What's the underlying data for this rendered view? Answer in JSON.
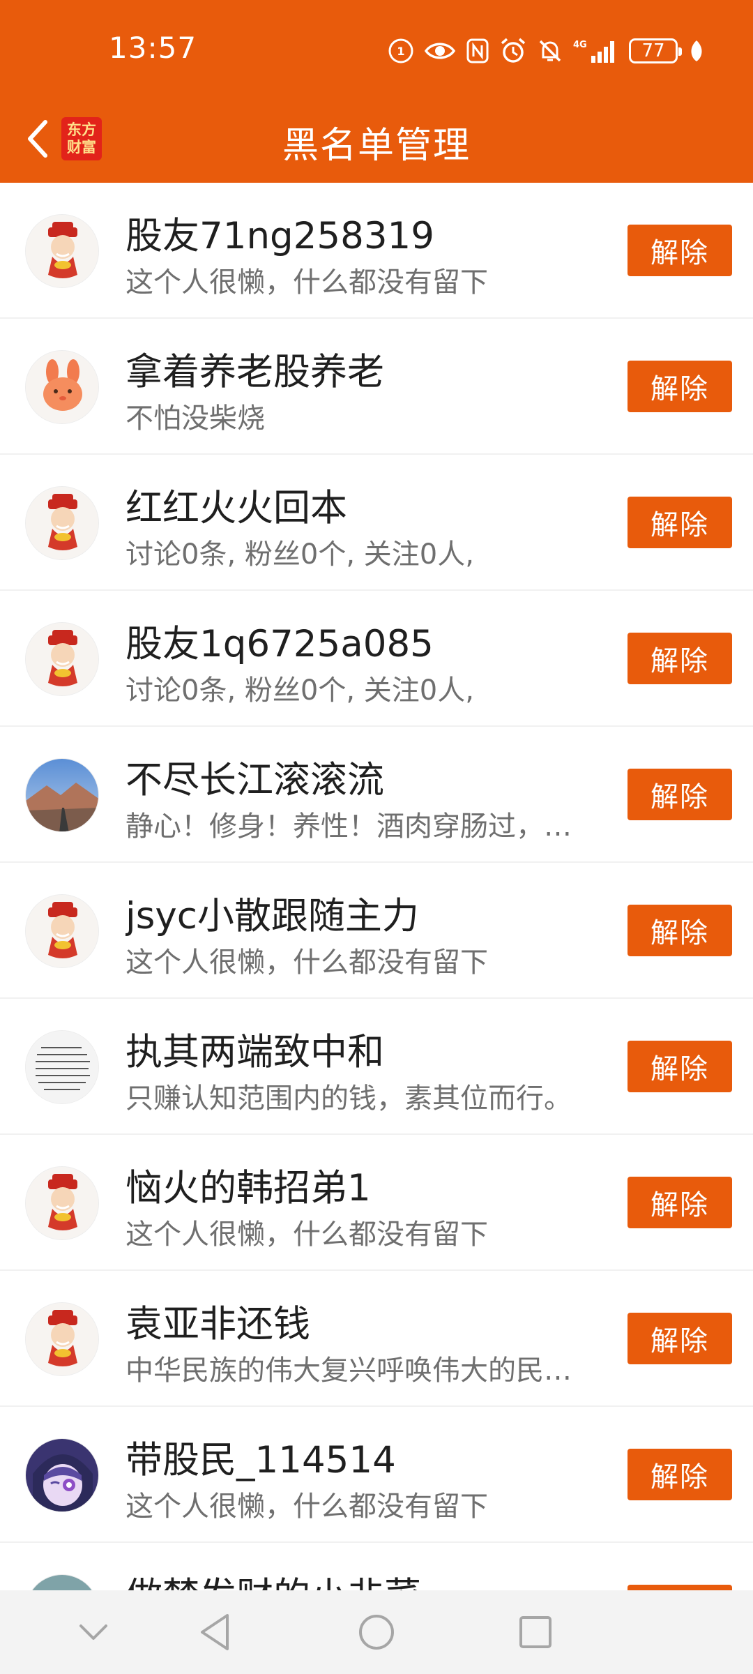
{
  "status": {
    "time": "13:57",
    "battery": "77"
  },
  "header": {
    "title": "黑名单管理",
    "logo_line1": "东方",
    "logo_line2": "财富"
  },
  "items": [
    {
      "name": "股友71ng258319",
      "bio": "这个人很懒，什么都没有留下",
      "button": "解除",
      "avatar": "caishen-avatar"
    },
    {
      "name": "拿着养老股养老",
      "bio": "不怕没柴烧",
      "button": "解除",
      "avatar": "rabbit-avatar"
    },
    {
      "name": "红红火火回本",
      "bio": "讨论0条, 粉丝0个, 关注0人,",
      "button": "解除",
      "avatar": "caishen-avatar"
    },
    {
      "name": "股友1q6725a085",
      "bio": "讨论0条, 粉丝0个, 关注0人,",
      "button": "解除",
      "avatar": "caishen-avatar"
    },
    {
      "name": "不尽长江滚滚流",
      "bio": "静心！修身！养性！酒肉穿肠过，…",
      "button": "解除",
      "avatar": "landscape-avatar"
    },
    {
      "name": "jsyc小散跟随主力",
      "bio": "这个人很懒，什么都没有留下",
      "button": "解除",
      "avatar": "caishen-avatar"
    },
    {
      "name": "执其两端致中和",
      "bio": "只赚认知范围内的钱，素其位而行。",
      "button": "解除",
      "avatar": "text-avatar"
    },
    {
      "name": "恼火的韩招弟1",
      "bio": "这个人很懒，什么都没有留下",
      "button": "解除",
      "avatar": "caishen-avatar"
    },
    {
      "name": "袁亚非还钱",
      "bio": "中华民族的伟大复兴呼唤伟大的民…",
      "button": "解除",
      "avatar": "caishen-avatar"
    },
    {
      "name": "带股民_114514",
      "bio": "这个人很懒，什么都没有留下",
      "button": "解除",
      "avatar": "anime-avatar"
    },
    {
      "name": "做梦发财的小韭菜",
      "bio": "",
      "button": "解除",
      "avatar": "landscape-avatar"
    }
  ],
  "colors": {
    "brand": "#E85B0C",
    "text": "#1F1F1F",
    "subtext": "#6F6F6F"
  }
}
